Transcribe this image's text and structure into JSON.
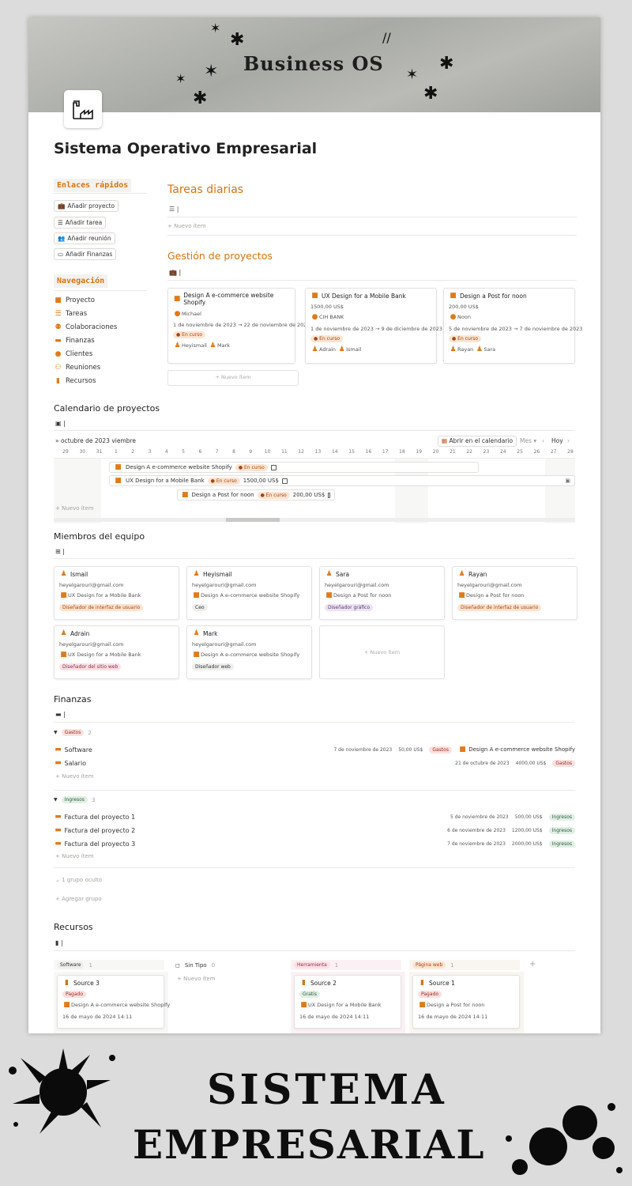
{
  "cover": {
    "title": "Business OS"
  },
  "page": {
    "title": "Sistema Operativo Empresarial"
  },
  "quick_links": {
    "heading": "Enlaces rápidos",
    "buttons": [
      "Añadir proyecto",
      "Añadir tarea",
      "Añadir reunión",
      "Añadir Finanzas"
    ]
  },
  "navigation": {
    "heading": "Navegación",
    "items": [
      "Proyecto",
      "Tareas",
      "Colaboraciones",
      "Finanzas",
      "Clientes",
      "Reuniones",
      "Recursos"
    ]
  },
  "daily_tasks": {
    "title": "Tareas diarias",
    "new_item": "Nuevo ítem"
  },
  "projects": {
    "title": "Gestión de proyectos",
    "new_item": "Nuevo ítem",
    "cards": [
      {
        "name": "Design A e-commerce website Shopify",
        "line2": "Michael",
        "line3": "1 de noviembre de 2023 → 22 de noviembre de 2023",
        "status": "En curso",
        "people": [
          "Heyismail",
          "Mark"
        ]
      },
      {
        "name": "UX Design for a Mobile Bank",
        "line2": "1500,00 US$",
        "line3": "CIH BANK",
        "line4": "1 de noviembre de 2023 → 9 de diciembre de 2023",
        "status": "En curso",
        "people": [
          "Adrain",
          "Ismail"
        ]
      },
      {
        "name": "Design a Post for noon",
        "line2": "200,00 US$",
        "line3": "Noon",
        "line4": "5 de noviembre de 2023 → 7 de noviembre de 2023",
        "status": "En curso",
        "people": [
          "Rayan",
          "Sara"
        ]
      }
    ]
  },
  "calendar": {
    "title": "Calendario de proyectos",
    "month": "octubre de 2023",
    "month_next": "viembre",
    "open_button": "Abrir en el calendario",
    "view": "Mes",
    "today": "Hoy",
    "days": [
      "29",
      "30",
      "31",
      "1",
      "2",
      "3",
      "4",
      "5",
      "6",
      "7",
      "8",
      "9",
      "10",
      "11",
      "12",
      "13",
      "14",
      "15",
      "16",
      "17",
      "18",
      "19",
      "20",
      "21",
      "22",
      "23",
      "24",
      "25",
      "26",
      "27",
      "28"
    ],
    "new_item": "Nuevo ítem",
    "bars": [
      {
        "name": "Design A e-commerce website Shopify",
        "status": "En curso",
        "amount": ""
      },
      {
        "name": "UX Design for a Mobile Bank",
        "status": "En curso",
        "amount": "1500,00 US$"
      },
      {
        "name": "Design a Post for noon",
        "status": "En curso",
        "amount": "200,00 US$"
      }
    ]
  },
  "team": {
    "title": "Miembros del equipo",
    "new_item": "Nuevo ítem",
    "members": [
      {
        "name": "Ismail",
        "email": "heyelgarouri@gmail.com",
        "project": "UX Design for a Mobile Bank",
        "role": "Diseñador de interfaz de usuario"
      },
      {
        "name": "Heyismail",
        "email": "heyelgarouri@gmail.com",
        "project": "Design A e-commerce website Shopify",
        "role": "Ceo"
      },
      {
        "name": "Sara",
        "email": "heyelgarouri@gmail.com",
        "project": "Design a Post for noon",
        "role": "Diseñador gráfico"
      },
      {
        "name": "Rayan",
        "email": "heyelgarouri@gmail.com",
        "project": "Design a Post for noon",
        "role": "Diseñador de interfaz de usuario"
      },
      {
        "name": "Adrain",
        "email": "heyelgarouri@gmail.com",
        "project": "UX Design for a Mobile Bank",
        "role": "Diseñador del sitio web"
      },
      {
        "name": "Mark",
        "email": "heyelgarouri@gmail.com",
        "project": "Design A e-commerce website Shopify",
        "role": "Diseñador web"
      }
    ]
  },
  "finance": {
    "title": "Finanzas",
    "groups": [
      {
        "name": "Gastos",
        "count": "2",
        "rows": [
          {
            "name": "Software",
            "date": "7 de noviembre de 2023",
            "amount": "50,00 US$",
            "tag": "Gastos",
            "project": "Design A e-commerce website Shopify"
          },
          {
            "name": "Salario",
            "date": "21 de octubre de 2023",
            "amount": "4000,00 US$",
            "tag": "Gastos",
            "project": ""
          }
        ]
      },
      {
        "name": "Ingresos",
        "count": "3",
        "rows": [
          {
            "name": "Factura del proyecto 1",
            "date": "5 de noviembre de 2023",
            "amount": "500,00 US$",
            "tag": "Ingresos"
          },
          {
            "name": "Factura del proyecto 2",
            "date": "6 de noviembre de 2023",
            "amount": "1200,00 US$",
            "tag": "Ingresos"
          },
          {
            "name": "Factura del proyecto 3",
            "date": "7 de noviembre de 2023",
            "amount": "2000,00 US$",
            "tag": "Ingresos"
          }
        ]
      }
    ],
    "new_item": "Nuevo ítem",
    "hidden_groups": "1 grupo oculto",
    "add_group": "Agregar grupo"
  },
  "resources": {
    "title": "Recursos",
    "columns": [
      {
        "name": "Software",
        "count": "1",
        "card": {
          "title": "Source 3",
          "tag": "Pagado",
          "project": "Design A e-commerce website Shopify",
          "date": "16 de mayo de 2024 14:11"
        }
      },
      {
        "name": "Sin Tipo",
        "count": "0",
        "new_item": "Nuevo ítem"
      },
      {
        "name": "Herramienta",
        "count": "1",
        "card": {
          "title": "Source 2",
          "tag": "Gratis",
          "project": "UX Design for a Mobile Bank",
          "date": "16 de mayo de 2024 14:11"
        }
      },
      {
        "name": "Página web",
        "count": "1",
        "card": {
          "title": "Source 1",
          "tag": "Pagado",
          "project": "Design a Post for noon",
          "date": "16 de mayo de 2024 14:11"
        }
      }
    ]
  },
  "banner": {
    "line1": "SISTEMA",
    "line2": "EMPRESARIAL"
  }
}
